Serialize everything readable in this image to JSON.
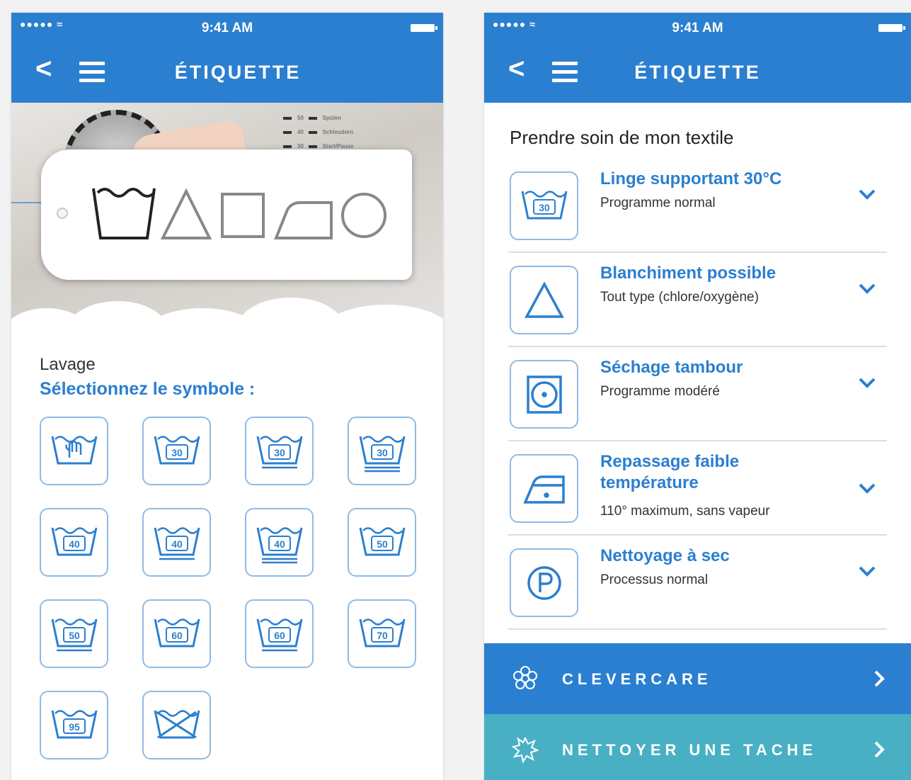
{
  "left": {
    "status": {
      "signal": "●●●●● ≈",
      "time": "9:41 AM"
    },
    "nav": {
      "back": "<",
      "title": "ÉTIQUETTE"
    },
    "hero_legend": [
      "50",
      "40",
      "30",
      "Spülen",
      "Schleudern",
      "Start/Pause"
    ],
    "section_label": "Lavage",
    "select_prompt": "Sélectionnez le symbole :",
    "symbols": [
      {
        "icon": "hand-wash-icon",
        "temp": "",
        "bars": 0
      },
      {
        "icon": "wash-30-icon",
        "temp": "30",
        "bars": 0
      },
      {
        "icon": "wash-30-mild-icon",
        "temp": "30",
        "bars": 1
      },
      {
        "icon": "wash-30-very-mild-icon",
        "temp": "30",
        "bars": 2
      },
      {
        "icon": "wash-40-icon",
        "temp": "40",
        "bars": 0
      },
      {
        "icon": "wash-40-mild-icon",
        "temp": "40",
        "bars": 1
      },
      {
        "icon": "wash-40-very-mild-icon",
        "temp": "40",
        "bars": 2
      },
      {
        "icon": "wash-50-icon",
        "temp": "50",
        "bars": 0
      },
      {
        "icon": "wash-50-mild-icon",
        "temp": "50",
        "bars": 1
      },
      {
        "icon": "wash-60-icon",
        "temp": "60",
        "bars": 0
      },
      {
        "icon": "wash-60-mild-icon",
        "temp": "60",
        "bars": 1
      },
      {
        "icon": "wash-70-icon",
        "temp": "70",
        "bars": 0
      },
      {
        "icon": "wash-95-icon",
        "temp": "95",
        "bars": 0
      },
      {
        "icon": "no-wash-icon",
        "temp": "",
        "bars": 0
      }
    ]
  },
  "right": {
    "status": {
      "signal": "●●●●● ≈",
      "time": "9:41 AM"
    },
    "nav": {
      "back": "<",
      "title": "ÉTIQUETTE"
    },
    "section_title": "Prendre soin de mon textile",
    "items": [
      {
        "icon": "wash-30-icon",
        "title": "Linge supportant 30°C",
        "subtitle": "Programme normal"
      },
      {
        "icon": "bleach-triangle-icon",
        "title": "Blanchiment possible",
        "subtitle": "Tout type (chlore/oxygène)"
      },
      {
        "icon": "tumble-dry-icon",
        "title": "Séchage tambour",
        "subtitle": "Programme modéré"
      },
      {
        "icon": "iron-low-icon",
        "title": "Repassage faible température",
        "subtitle": "110° maximum, sans vapeur"
      },
      {
        "icon": "dry-clean-p-icon",
        "title": "Nettoyage à sec",
        "subtitle": "Processus normal"
      }
    ],
    "buttons": [
      {
        "label": "CLEVERCARE",
        "icon": "flower-icon"
      },
      {
        "label": "NETTOYER UNE TACHE",
        "icon": "stain-icon"
      }
    ]
  },
  "colors": {
    "primary": "#2b7fd0",
    "teal": "#49b0c4",
    "icon_border": "#8fbbe3"
  }
}
